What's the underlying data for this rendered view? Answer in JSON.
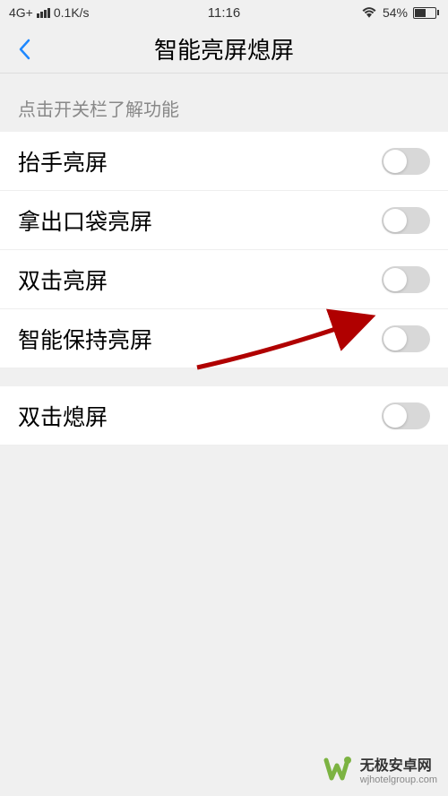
{
  "status_bar": {
    "network": "4G+",
    "speed": "0.1K/s",
    "time": "11:16",
    "battery_percent": "54%"
  },
  "header": {
    "title": "智能亮屏熄屏"
  },
  "section_header": "点击开关栏了解功能",
  "settings": [
    {
      "label": "抬手亮屏",
      "enabled": false
    },
    {
      "label": "拿出口袋亮屏",
      "enabled": false
    },
    {
      "label": "双击亮屏",
      "enabled": false
    },
    {
      "label": "智能保持亮屏",
      "enabled": false
    }
  ],
  "settings2": [
    {
      "label": "双击熄屏",
      "enabled": false
    }
  ],
  "watermark": {
    "title": "无极安卓网",
    "url": "wjhotelgroup.com"
  }
}
